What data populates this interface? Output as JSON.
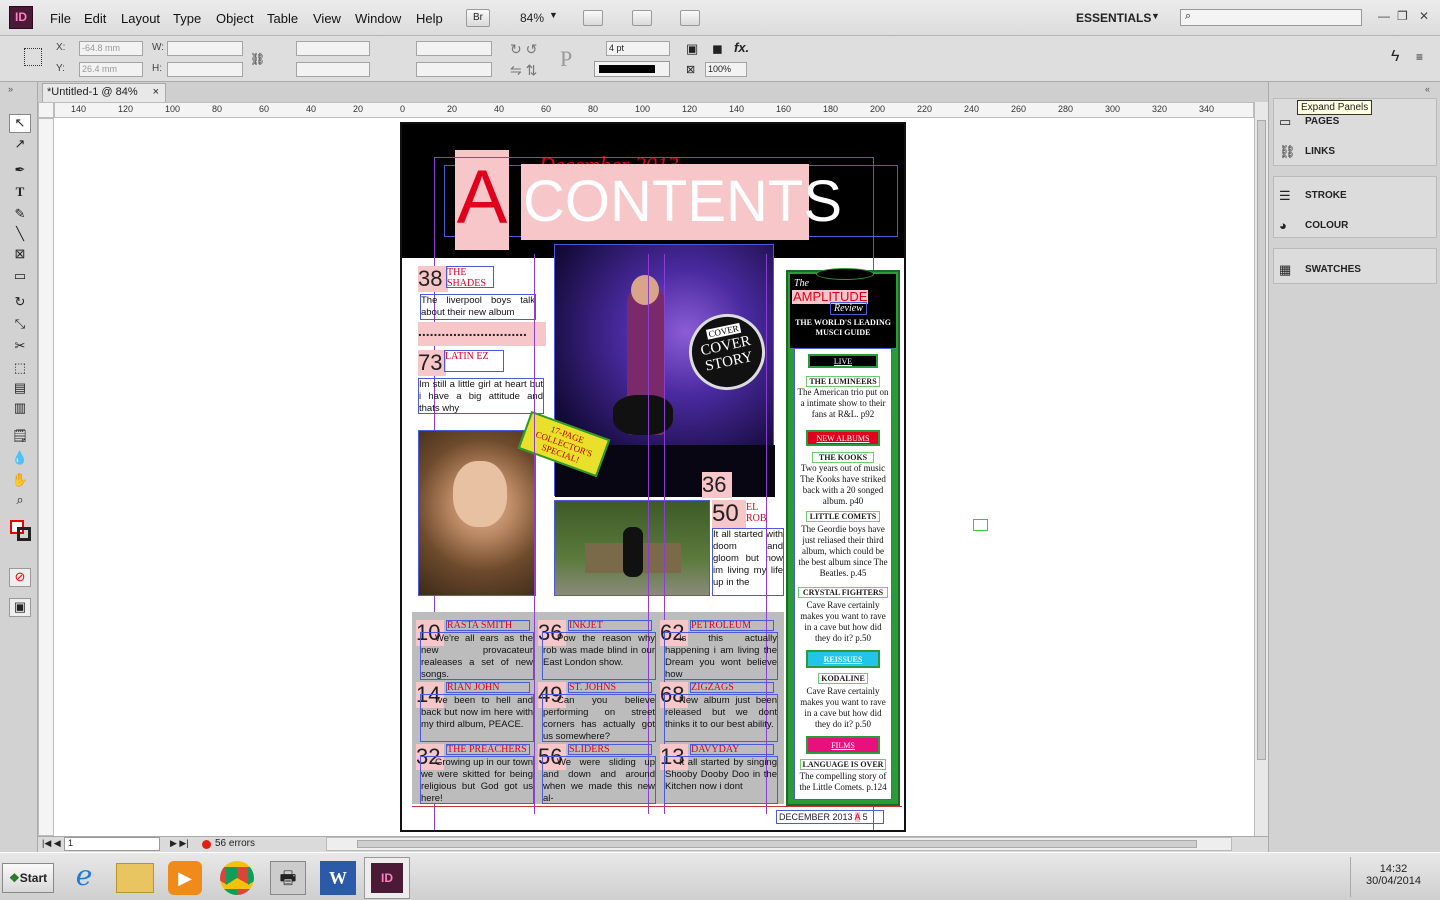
{
  "menubar": {
    "logo": "ID",
    "items": [
      "File",
      "Edit",
      "Layout",
      "Type",
      "Object",
      "Table",
      "View",
      "Window",
      "Help"
    ],
    "br": "Br",
    "zoom": "84%",
    "workspace": "ESSENTIALS"
  },
  "control": {
    "x_label": "X:",
    "x_value": "-64.8 mm",
    "y_label": "Y:",
    "y_value": "26.4 mm",
    "w_label": "W:",
    "h_label": "H:",
    "stroke_weight": "4 pt",
    "opacity": "100%",
    "fx": "fx."
  },
  "tab": {
    "title": "*Untitled-1 @ 84%",
    "close": "×"
  },
  "ruler": {
    "h_ticks": [
      "140",
      "120",
      "100",
      "80",
      "60",
      "40",
      "20",
      "0",
      "20",
      "40",
      "60",
      "80",
      "100",
      "120",
      "140",
      "160",
      "180",
      "200",
      "220",
      "240",
      "260",
      "280",
      "300",
      "320",
      "340"
    ]
  },
  "panels": {
    "tooltip": "Expand Panels",
    "items": [
      "PAGES",
      "LINKS",
      "STROKE",
      "COLOUR",
      "SWATCHES"
    ]
  },
  "status": {
    "page": "1",
    "errors": "56 errors"
  },
  "artwork": {
    "date_header": "December 2013",
    "letter": "A",
    "title": "CONTENTS",
    "cover_badge_small": "COVER",
    "cover_story": "COVER STORY",
    "special": "17-PAGE COLLECTOR'S SPECIAL!",
    "stories_left": [
      {
        "num": "38",
        "head": "THE SHADES",
        "text": "The liverpool boys talk about their new album"
      },
      {
        "num": "73",
        "head": "LATIN EZ",
        "text": "Im still a little girl at heart but i have a big attitude and thats why"
      }
    ],
    "dots": "............................",
    "story_50": {
      "num": "50",
      "head": "EL ROB",
      "text": "It all started with doom and gloom but now im living my life up in the"
    },
    "story_36": "36",
    "grid": [
      {
        "num": "10",
        "head": "RASTA SMITH",
        "text": "We're all ears as the new provacateur realeases a set of new songs."
      },
      {
        "num": "36",
        "head": "INKJET",
        "text": "Pow the reason why rob was made blind in our East London show."
      },
      {
        "num": "62",
        "head": "PETROLEUM",
        "text": "Is this actually happening i am living the Dream you wont believe how"
      },
      {
        "num": "14",
        "head": "RIAN JOHN",
        "text": "Ive been to hell and back but now im here with my third album, PEACE."
      },
      {
        "num": "49",
        "head": "ST. JOHNS",
        "text": "Can you believe performing on street corners has actually got us somewhere?"
      },
      {
        "num": "68",
        "head": "ZIGZAGS",
        "text": "New album just been released but we dont thinks it to our best ability."
      },
      {
        "num": "32",
        "head": "THE PREACHERS",
        "text": "Growing up in our town we were skitted for being religious but God got us here!"
      },
      {
        "num": "56",
        "head": "SLIDERS",
        "text": "We were sliding up and down and around when we made this new al-"
      },
      {
        "num": "13",
        "head": "DAVYDAY",
        "text": "It all started by singing Shooby Dooby Doo in the Kitchen now i dont"
      }
    ],
    "footer": {
      "date": "DECEMBER 2013",
      "letter": "A",
      "page": "5"
    },
    "sidebar": {
      "the": "The",
      "brand": "AMPLITUDE",
      "review": "Review",
      "tagline": "THE WORLD'S LEADING MUSCI GUIDE",
      "live": "LIVE",
      "lumineers_h": "THE LUMINEERS",
      "lumineers_t": "The American trio put on a intimate show to their fans at R&L. p92",
      "new_albums": "NEW ALBUMS",
      "kooks_h": "THE KOOKS",
      "kooks_t": "Two years out of music The Kooks have striked back with a 20 songed album. p40",
      "comets_h": "LITTLE COMETS",
      "comets_t": "The Geordie boys have just reliased their third album, which could be the best album since The Beatles. p.45",
      "crystal_h": "CRYSTAL FIGHTERS",
      "crystal_t": "Cave Rave certainly makes you want to rave in a cave but how did they do it? p.50",
      "reissues": "REISSUES",
      "kodaline_h": "KODALINE",
      "kodaline_t": "Cave Rave certainly makes you want to rave in a cave but how did they do it? p.50",
      "films": "FILMS",
      "lang_h": "LANGUAGE IS OVER",
      "lang_t": "The compelling story of the Little Comets. p.124"
    }
  },
  "taskbar": {
    "start": "Start",
    "time": "14:32",
    "date": "30/04/2014"
  }
}
